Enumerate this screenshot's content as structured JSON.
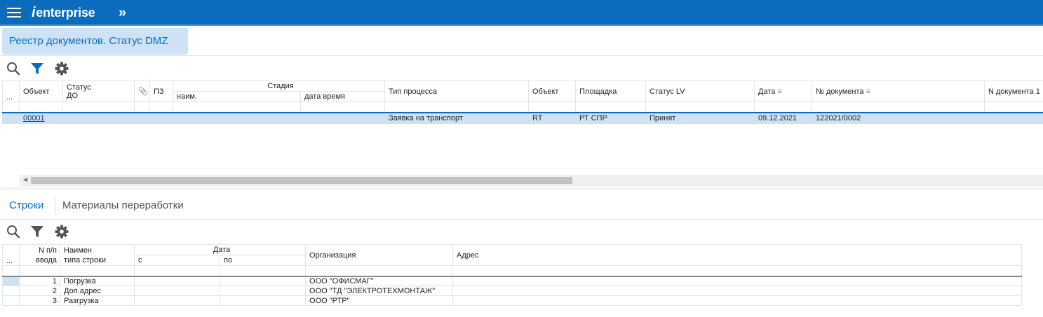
{
  "app": {
    "logo_prefix": "i",
    "logo_text": "enterprise",
    "expand_glyph": "»"
  },
  "document_tab": {
    "title": "Реестр документов. Статус DMZ"
  },
  "icons": {
    "menu": "hamburger-menu-icon",
    "search": "search-icon",
    "filter": "filter-icon",
    "settings": "gear-icon",
    "attachment": "paperclip-icon",
    "sort": "sort-icon"
  },
  "colors": {
    "brand": "#0b6bbd",
    "selection": "#cfe1f3",
    "filter_active": "#0b6bbd",
    "icon_gray": "#555555"
  },
  "main_grid": {
    "row_marker": "...",
    "headers": {
      "object": "Объект",
      "status_do_1": "Статус",
      "status_do_2": "ДО",
      "attach": "📎",
      "pz": "ПЗ",
      "stage": "Стадия",
      "stage_name": "наим.",
      "stage_datetime": "дата время",
      "process_type": "Тип процесса",
      "object2": "Объект",
      "site": "Площадка",
      "status_lv": "Статус LV",
      "date": "Дата",
      "doc_no": "№ документа",
      "n_doc": "N документа 1"
    },
    "rows": [
      {
        "object": "00001",
        "status_do": "",
        "pz": "",
        "stage_name": "",
        "stage_datetime": "",
        "process_type": "Заявка на транспорт",
        "object2": "RT",
        "site": "РТ СПР",
        "status_lv": "Принят",
        "date": "09.12.2021",
        "doc_no": "122021/0002",
        "n_doc": ""
      }
    ]
  },
  "subtabs": [
    {
      "label": "Строки",
      "active": true
    },
    {
      "label": "Материалы переработки",
      "active": false
    }
  ],
  "lines_grid": {
    "row_marker": "...",
    "headers": {
      "n_1": "N п/п",
      "n_2": "ввода",
      "name_1": "Наимен",
      "name_2": "типа строки",
      "date": "Дата",
      "date_from": "с",
      "date_to": "по",
      "org": "Организация",
      "address": "Адрес"
    },
    "rows": [
      {
        "n": "1",
        "name": "Погрузка",
        "from": "",
        "to": "",
        "org": "ООО \"ОФИСМАГ\"",
        "address": ""
      },
      {
        "n": "2",
        "name": "Доп.адрес",
        "from": "",
        "to": "",
        "org": "ООО \"ТД \"ЭЛЕКТРОТЕХМОНТАЖ\"",
        "address": ""
      },
      {
        "n": "3",
        "name": "Разгрузка",
        "from": "",
        "to": "",
        "org": "ООО \"РТР\"",
        "address": ""
      }
    ]
  }
}
